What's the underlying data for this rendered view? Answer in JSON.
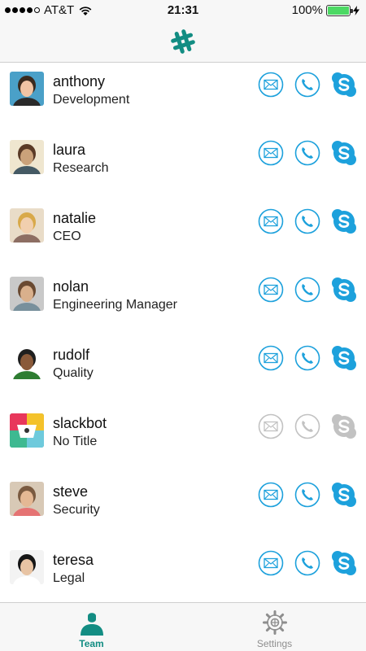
{
  "status_bar": {
    "carrier": "AT&T",
    "time": "21:31",
    "battery_percent": "100%",
    "battery_level": 1.0
  },
  "nav_bar": {
    "logo_icon": "slack-hash-icon"
  },
  "colors": {
    "accent": "#1da1dc",
    "brand_teal": "#138d83",
    "disabled": "#c2c2c2"
  },
  "contacts": [
    {
      "name": "anthony",
      "title": "Development",
      "enabled": true
    },
    {
      "name": "laura",
      "title": "Research",
      "enabled": true
    },
    {
      "name": "natalie",
      "title": "CEO",
      "enabled": true
    },
    {
      "name": "nolan",
      "title": "Engineering Manager",
      "enabled": true
    },
    {
      "name": "rudolf",
      "title": "Quality",
      "enabled": true
    },
    {
      "name": "slackbot",
      "title": "No Title",
      "enabled": false
    },
    {
      "name": "steve",
      "title": "Security",
      "enabled": true
    },
    {
      "name": "teresa",
      "title": "Legal",
      "enabled": true
    }
  ],
  "tab_bar": {
    "tabs": [
      {
        "label": "Team",
        "icon": "person-icon",
        "active": true
      },
      {
        "label": "Settings",
        "icon": "gear-icon",
        "active": false
      }
    ]
  }
}
